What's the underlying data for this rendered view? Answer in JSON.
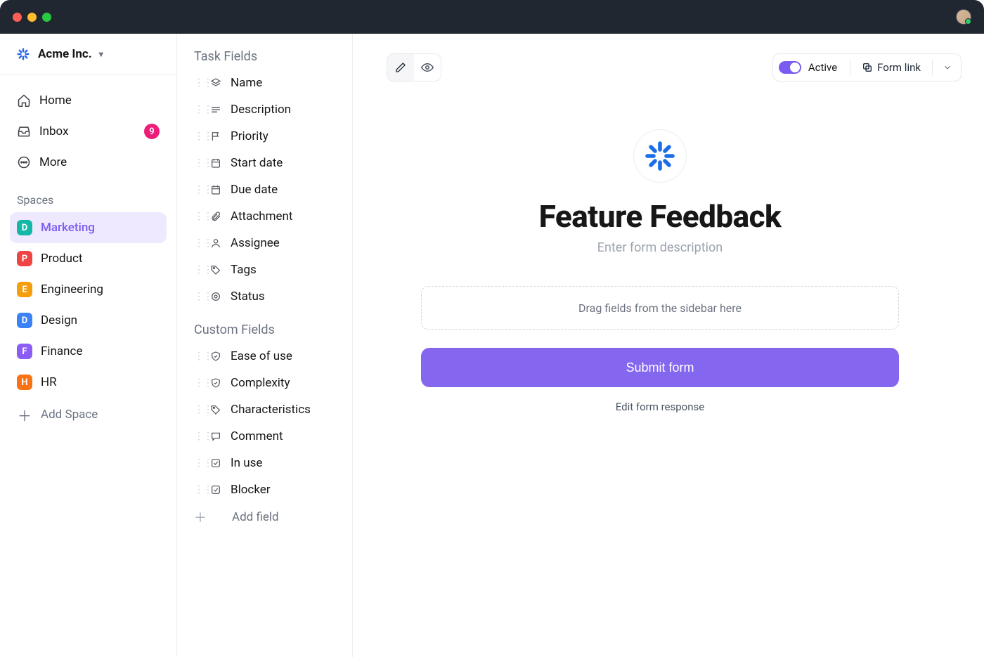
{
  "org": {
    "name": "Acme Inc."
  },
  "nav": {
    "home": "Home",
    "inbox": "Inbox",
    "inbox_count": "9",
    "more": "More"
  },
  "spaces_label": "Spaces",
  "spaces": [
    {
      "letter": "D",
      "color": "#14b8a6",
      "label": "Marketing",
      "active": true
    },
    {
      "letter": "P",
      "color": "#ef4444",
      "label": "Product"
    },
    {
      "letter": "E",
      "color": "#f59e0b",
      "label": "Engineering"
    },
    {
      "letter": "D",
      "color": "#3b82f6",
      "label": "Design"
    },
    {
      "letter": "F",
      "color": "#8b5cf6",
      "label": "Finance"
    },
    {
      "letter": "H",
      "color": "#f97316",
      "label": "HR"
    }
  ],
  "add_space_label": "Add Space",
  "fields_panel": {
    "task_heading": "Task Fields",
    "task_fields": [
      {
        "icon": "layers",
        "label": "Name"
      },
      {
        "icon": "lines",
        "label": "Description"
      },
      {
        "icon": "flag",
        "label": "Priority"
      },
      {
        "icon": "calendar",
        "label": "Start date"
      },
      {
        "icon": "calendar",
        "label": "Due date"
      },
      {
        "icon": "paperclip",
        "label": "Attachment"
      },
      {
        "icon": "user",
        "label": "Assignee"
      },
      {
        "icon": "tag",
        "label": "Tags"
      },
      {
        "icon": "status",
        "label": "Status"
      }
    ],
    "custom_heading": "Custom Fields",
    "custom_fields": [
      {
        "icon": "shield",
        "label": "Ease of use"
      },
      {
        "icon": "shield",
        "label": "Complexity"
      },
      {
        "icon": "tag",
        "label": "Characteristics"
      },
      {
        "icon": "comment",
        "label": "Comment"
      },
      {
        "icon": "check",
        "label": "In use"
      },
      {
        "icon": "check",
        "label": "Blocker"
      }
    ],
    "add_field_label": "Add field"
  },
  "toolbar": {
    "active_label": "Active",
    "form_link_label": "Form link"
  },
  "form": {
    "title": "Feature Feedback",
    "description_placeholder": "Enter form description",
    "drop_hint": "Drag fields from the sidebar here",
    "submit_label": "Submit form",
    "edit_response_label": "Edit form response"
  }
}
